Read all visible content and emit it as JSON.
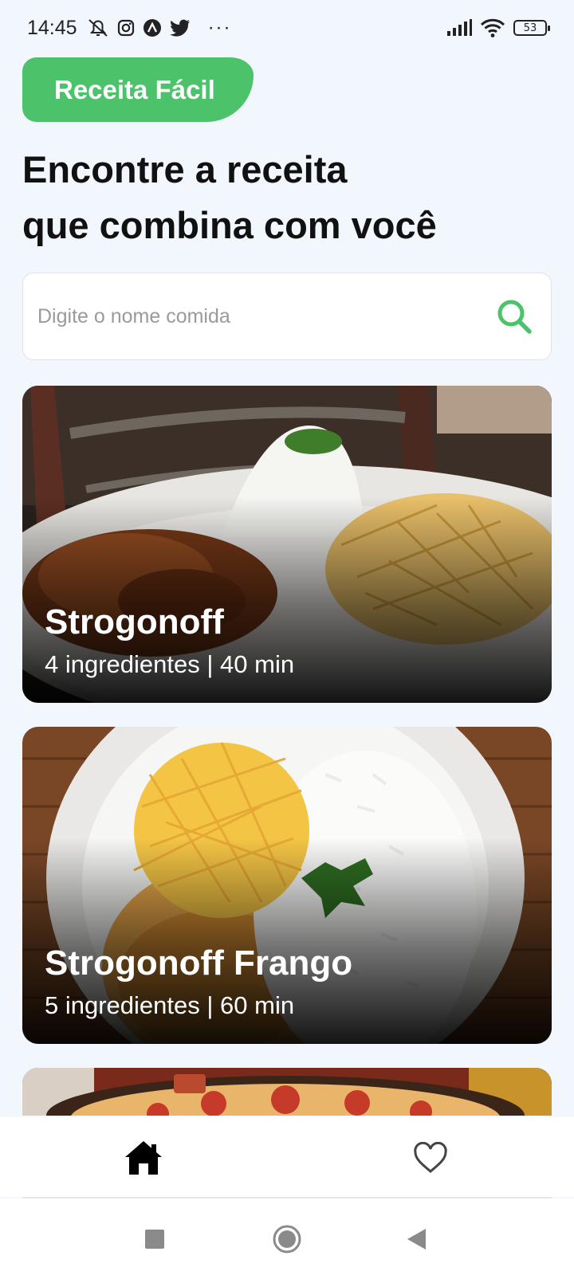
{
  "status_bar": {
    "time": "14:45",
    "battery": "53",
    "icons": [
      "mute-icon",
      "instagram-icon",
      "app-icon",
      "twitter-icon",
      "more-icon",
      "signal-icon",
      "wifi-icon",
      "battery-icon"
    ],
    "more": "···"
  },
  "app": {
    "logo_text": "Receita Fácil",
    "accent_color": "#4cc26a"
  },
  "headline": {
    "line1": "Encontre a receita",
    "line2": "que combina com você"
  },
  "search": {
    "placeholder": "Digite o nome comida",
    "value": ""
  },
  "recipes": [
    {
      "name": "Strogonoff",
      "info": "4 ingredientes | 40 min"
    },
    {
      "name": "Strogonoff Frango",
      "info": "5 ingredientes | 60 min"
    },
    {
      "name": "",
      "info": ""
    }
  ],
  "tabs": [
    {
      "name": "home-icon",
      "active": true
    },
    {
      "name": "heart-icon",
      "active": false
    }
  ],
  "system_nav": [
    "recent-apps-icon",
    "home-circle-icon",
    "back-triangle-icon"
  ]
}
